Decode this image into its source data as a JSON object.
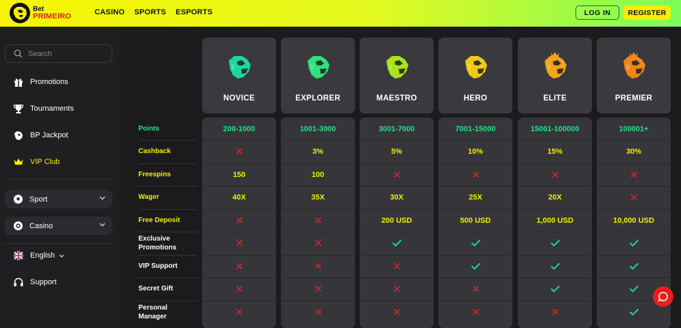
{
  "header": {
    "logo_line1": "Bet",
    "logo_line2": "PRIMEIRO",
    "nav": [
      "CASINO",
      "SPORTS",
      "ESPORTS"
    ],
    "login_label": "LOG IN",
    "register_label": "REGISTER"
  },
  "sidebar": {
    "search_placeholder": "Search",
    "items": [
      {
        "label": "Promotions",
        "icon": "gift-icon"
      },
      {
        "label": "Tournaments",
        "icon": "trophy-icon"
      },
      {
        "label": "BP Jackpot",
        "icon": "jaguar-icon"
      },
      {
        "label": "VIP Club",
        "icon": "crown-icon"
      }
    ],
    "pills": [
      {
        "label": "Sport",
        "icon": "ball-icon"
      },
      {
        "label": "Casino",
        "icon": "chip-icon"
      }
    ],
    "language": "English",
    "support": "Support"
  },
  "tiers": [
    {
      "name": "NOVICE",
      "color": "#1fd79a"
    },
    {
      "name": "EXPLORER",
      "color": "#2fe07c"
    },
    {
      "name": "MAESTRO",
      "color": "#a8e31c"
    },
    {
      "name": "HERO",
      "color": "#f0c81a"
    },
    {
      "name": "ELITE",
      "color": "#f2a41c"
    },
    {
      "name": "PREMIER",
      "color": "#f0861a"
    }
  ],
  "rows": [
    {
      "label": "Points",
      "label_color": "green",
      "values": [
        "200-1000",
        "1001-3000",
        "3001-7000",
        "7001-15000",
        "15001-100000",
        "100001+"
      ],
      "value_color": "green"
    },
    {
      "label": "Cashback",
      "label_color": "yellow",
      "values": [
        "x",
        "3%",
        "5%",
        "10%",
        "15%",
        "30%"
      ],
      "value_color": "yellow"
    },
    {
      "label": "Freespins",
      "label_color": "yellow",
      "values": [
        "150",
        "100",
        "x",
        "x",
        "x",
        "x"
      ],
      "value_color": "yellow"
    },
    {
      "label": "Wager",
      "label_color": "yellow",
      "values": [
        "40X",
        "35X",
        "30X",
        "25X",
        "20X",
        "x"
      ],
      "value_color": "yellow"
    },
    {
      "label": "Free Deposit",
      "label_color": "yellow",
      "values": [
        "x",
        "x",
        "200 USD",
        "500 USD",
        "1,000 USD",
        "10,000 USD"
      ],
      "value_color": "yellow"
    },
    {
      "label": "Exclusive Promotions",
      "label_color": "white",
      "values": [
        "x",
        "x",
        "check",
        "check",
        "check",
        "check"
      ],
      "value_color": "white"
    },
    {
      "label": "VIP Support",
      "label_color": "white",
      "values": [
        "x",
        "x",
        "x",
        "check",
        "check",
        "check"
      ],
      "value_color": "white"
    },
    {
      "label": "Secret Gift",
      "label_color": "white",
      "values": [
        "x",
        "x",
        "x",
        "x",
        "check",
        "check"
      ],
      "value_color": "white"
    },
    {
      "label": "Personal Manager",
      "label_color": "white",
      "values": [
        "x",
        "x",
        "x",
        "x",
        "x",
        "check"
      ],
      "value_color": "white"
    }
  ],
  "colors": {
    "cross": "#c22a2a",
    "check": "#20d68a",
    "accent_yellow": "#f3ef00",
    "accent_green": "#20e28a"
  }
}
